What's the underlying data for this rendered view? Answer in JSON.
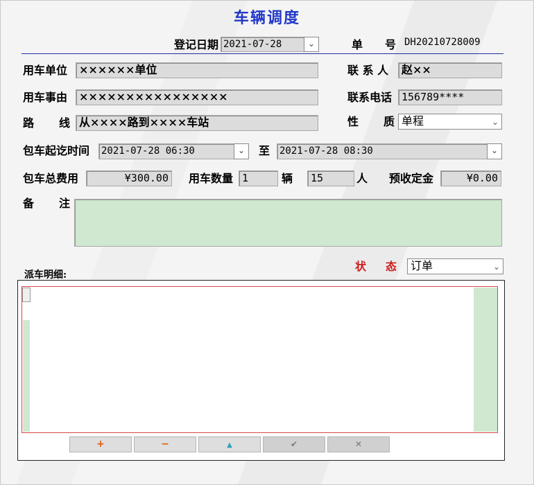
{
  "title": "车辆调度",
  "header": {
    "reg_date_label": "登记日期",
    "reg_date_value": "2021-07-28",
    "order_no_label_1": "单",
    "order_no_label_2": "号",
    "order_no_value": "DH20210728009"
  },
  "form": {
    "unit_label": "用车单位",
    "unit_value": "××××××单位",
    "contact_label": "联 系 人",
    "contact_value": "赵××",
    "reason_label": "用车事由",
    "reason_value": "××××××××××××××××",
    "phone_label": "联系电话",
    "phone_value": "156789****",
    "route_label_1": "路",
    "route_label_2": "线",
    "route_value": "从××××路到××××车站",
    "nature_label_1": "性",
    "nature_label_2": "质",
    "nature_value": "单程",
    "period_label": "包车起讫时间",
    "period_start": "2021-07-28 06:30",
    "period_to": "至",
    "period_end": "2021-07-28 08:30",
    "total_fee_label": "包车总费用",
    "total_fee_value": "¥300.00",
    "qty_label": "用车数量",
    "qty_value": "1",
    "qty_unit": "辆",
    "people_value": "15",
    "people_unit": "人",
    "deposit_label": "预收定金",
    "deposit_value": "¥0.00",
    "remark_label_1": "备",
    "remark_label_2": "注"
  },
  "status": {
    "label_1": "状",
    "label_2": "态",
    "value": "订单",
    "color": "#cc1a1a"
  },
  "detail": {
    "label": "派车明细:",
    "nav_buttons": [
      {
        "icon": "plus-icon",
        "glyph": "+",
        "color": "#e05a10"
      },
      {
        "icon": "minus-icon",
        "glyph": "−",
        "color": "#e05a10"
      },
      {
        "icon": "up-triangle-icon",
        "glyph": "▲",
        "color": "#2aa0c0"
      },
      {
        "icon": "check-icon",
        "glyph": "✔",
        "color": "#777777"
      },
      {
        "icon": "close-icon",
        "glyph": "✕",
        "color": "#777777"
      }
    ]
  },
  "colors": {
    "title": "#2238c8",
    "memo_bg": "#cfe8cf",
    "grid_border": "#d8434a"
  }
}
